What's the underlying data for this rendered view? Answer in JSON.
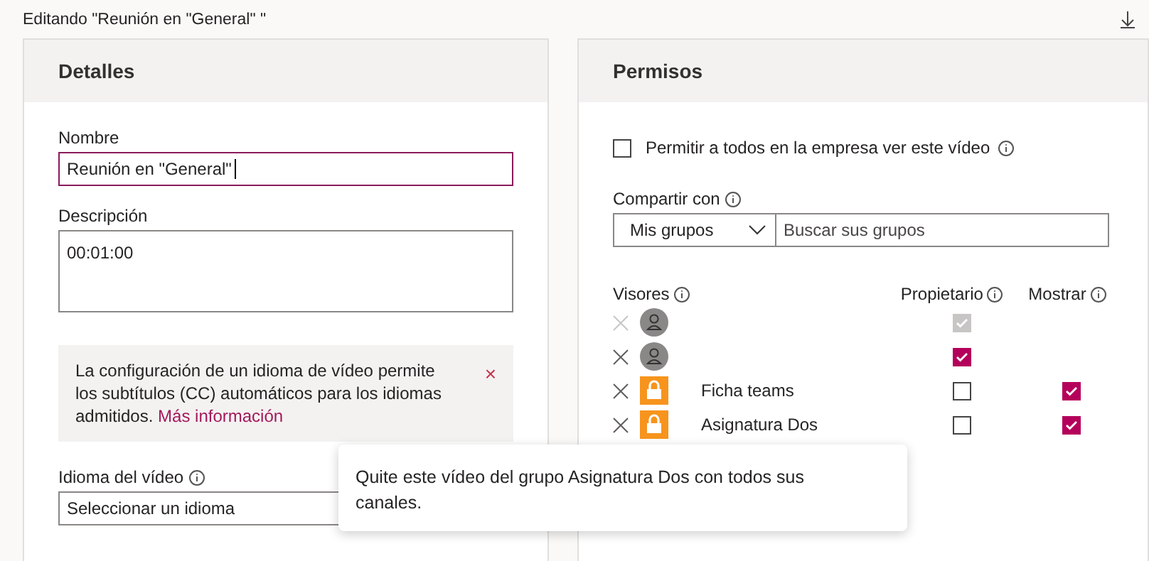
{
  "header": {
    "title": "Editando \"Reunión en \"General\" \""
  },
  "details": {
    "title": "Detalles",
    "name": {
      "label": "Nombre",
      "value": "Reunión en \"General\""
    },
    "description": {
      "label": "Descripción",
      "value": "00:01:00"
    },
    "notice": {
      "text": "La configuración de un idioma de vídeo permite los subtítulos (CC) automáticos para los idiomas admitidos.",
      "link": "Más información",
      "close": "×"
    },
    "language": {
      "label": "Idioma del vídeo",
      "value": "Seleccionar un idioma"
    }
  },
  "permissions": {
    "title": "Permisos",
    "allow_all": {
      "label": "Permitir a todos en la empresa ver este vídeo",
      "checked": false
    },
    "share": {
      "label": "Compartir con",
      "scope": "Mis grupos",
      "placeholder": "Buscar sus grupos"
    },
    "columns": {
      "viewers": "Visores",
      "owner": "Propietario",
      "show": "Mostrar"
    },
    "viewers": [
      {
        "kind": "person",
        "disabled": true,
        "owner": true
      },
      {
        "kind": "person",
        "disabled": false,
        "owner": true
      },
      {
        "kind": "group",
        "name": "Ficha teams",
        "disabled": false,
        "owner": false,
        "show": true
      },
      {
        "kind": "group",
        "name": "Asignatura Dos",
        "disabled": false,
        "owner": false,
        "show": true
      }
    ]
  },
  "tooltip": {
    "text": "Quite este vídeo del grupo Asignatura Dos con todos sus canales."
  }
}
